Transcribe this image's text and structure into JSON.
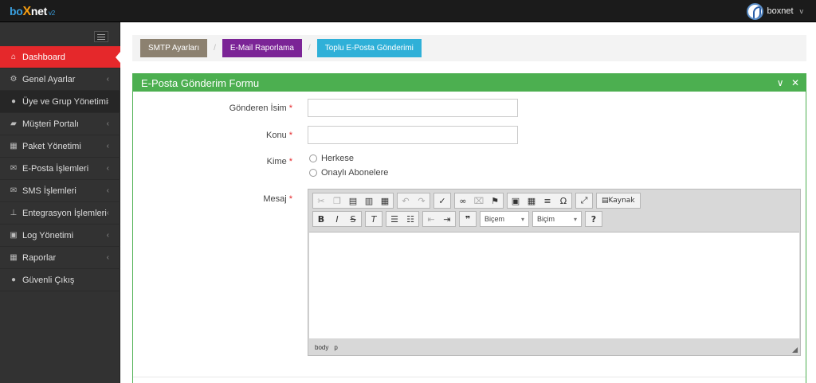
{
  "brand": {
    "logo_part1": "bo",
    "logo_part2": "X",
    "logo_part3": "net",
    "version": "v2"
  },
  "user": {
    "name": "boxnet",
    "caret": "v"
  },
  "sidebar": {
    "items": [
      {
        "label": "Dashboard",
        "icon": "home-icon",
        "glyph": "⌂",
        "arrow": ""
      },
      {
        "label": "Genel Ayarlar",
        "icon": "cogs-icon",
        "glyph": "⚙",
        "arrow": "‹"
      },
      {
        "label": "Üye ve Grup Yönetimi",
        "icon": "user-icon",
        "glyph": "●",
        "arrow": "‹"
      },
      {
        "label": "Müşteri Portalı",
        "icon": "folder-icon",
        "glyph": "▰",
        "arrow": "‹"
      },
      {
        "label": "Paket Yönetimi",
        "icon": "table-icon",
        "glyph": "▦",
        "arrow": "‹"
      },
      {
        "label": "E-Posta İşlemleri",
        "icon": "envelope-icon",
        "glyph": "✉",
        "arrow": "‹"
      },
      {
        "label": "SMS İşlemleri",
        "icon": "envelope-icon",
        "glyph": "✉",
        "arrow": "‹"
      },
      {
        "label": "Entegrasyon İşlemleri",
        "icon": "sitemap-icon",
        "glyph": "⊥",
        "arrow": "‹"
      },
      {
        "label": "Log Yönetimi",
        "icon": "lock-icon",
        "glyph": "▣",
        "arrow": "‹"
      },
      {
        "label": "Raporlar",
        "icon": "grid-icon",
        "glyph": "▦",
        "arrow": "‹"
      },
      {
        "label": "Güvenli Çıkış",
        "icon": "user-icon",
        "glyph": "●",
        "arrow": ""
      }
    ]
  },
  "breadcrumbs": {
    "items": [
      {
        "label": "SMTP Ayarları"
      },
      {
        "label": "E-Mail Raporlama"
      },
      {
        "label": "Toplu E-Posta Gönderimi"
      }
    ],
    "separator": "/"
  },
  "form": {
    "title": "E-Posta Gönderim Formu",
    "tools": {
      "collapse": "∨",
      "close": "✕"
    },
    "sender_label": "Gönderen İsim",
    "sender_value": "",
    "subject_label": "Konu",
    "subject_value": "",
    "to_label": "Kime",
    "to_options": [
      {
        "label": "Herkese"
      },
      {
        "label": "Onaylı Abonelere"
      }
    ],
    "message_label": "Mesaj",
    "required_mark": "*"
  },
  "editor": {
    "format_label": "Biçem",
    "style_label": "Biçim",
    "source_label": "Kaynak",
    "help_glyph": "?",
    "path": [
      "body",
      "p"
    ]
  }
}
